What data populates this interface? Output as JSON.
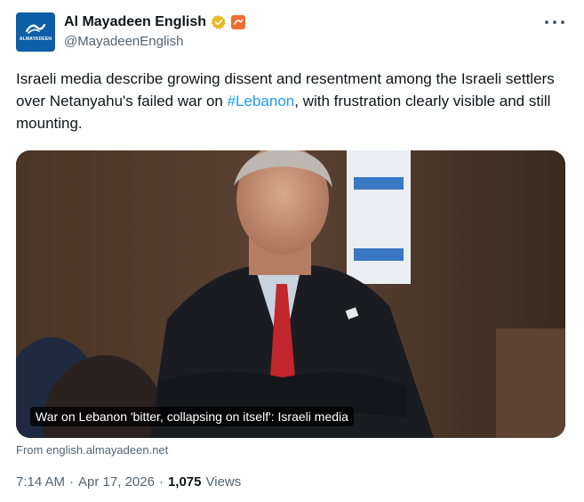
{
  "account": {
    "display_name": "Al Mayadeen English",
    "handle": "@MayadeenEnglish",
    "avatar_text": "ALMAYADEEN",
    "verified_badge": "gold-check-icon",
    "affiliate_badge": "al-mayadeen-affiliate-icon"
  },
  "tweet": {
    "text_before": "Israeli media describe growing dissent and resentment among the Israeli settlers over Netanyahu's failed war on ",
    "hashtag": "#Lebanon",
    "text_after": ", with frustration clearly visible and still mounting."
  },
  "card": {
    "title": "War on Lebanon 'bitter, collapsing on itself': Israeli media",
    "source": "From english.almayadeen.net"
  },
  "meta": {
    "time": "7:14 AM",
    "separator": "·",
    "date": "Apr 17, 2026",
    "views_count": "1,075",
    "views_label": "Views"
  },
  "colors": {
    "link": "#1d9bf0",
    "secondary_text": "#536471",
    "primary_text": "#0f1419",
    "brand": "#0c5fa8"
  }
}
